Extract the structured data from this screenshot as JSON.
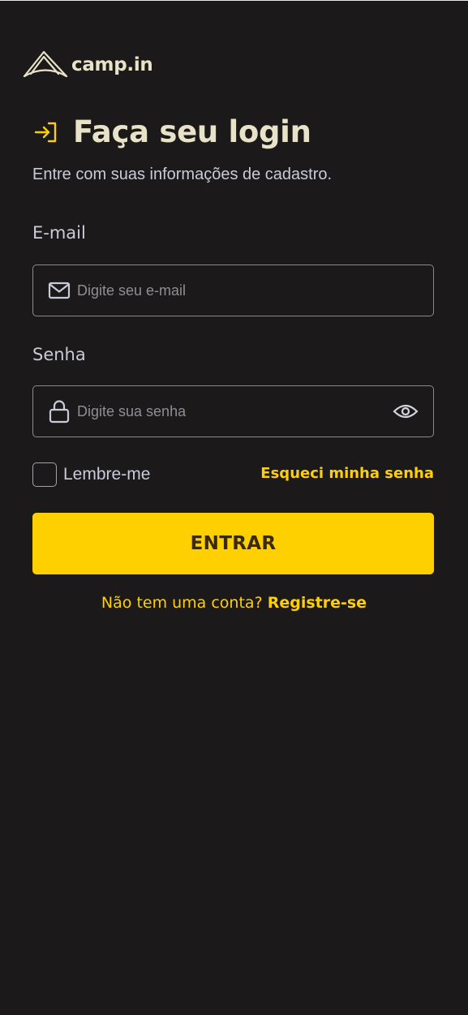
{
  "brand": {
    "name": "camp.in",
    "logo_icon": "tent-icon",
    "text_color": "#e8e2c8"
  },
  "header": {
    "title": "Faça seu login",
    "title_icon": "login-arrow-icon",
    "subtitle": "Entre com suas informações de cadastro."
  },
  "form": {
    "email": {
      "label": "E-mail",
      "placeholder": "Digite seu e-mail",
      "value": "",
      "icon": "mail-icon"
    },
    "password": {
      "label": "Senha",
      "placeholder": "Digite sua senha",
      "value": "",
      "icon": "lock-icon",
      "toggle_icon": "eye-icon"
    },
    "remember_label": "Lembre-me",
    "remember_checked": false,
    "forgot_label": "Esqueci minha senha",
    "submit_label": "ENTRAR"
  },
  "footer": {
    "prompt": "Não tem uma conta? ",
    "register_label": "Registre-se"
  },
  "colors": {
    "background": "#1b1919",
    "accent": "#ffd000",
    "muted_text": "#c9cbd8",
    "border": "#8a8a8e"
  }
}
